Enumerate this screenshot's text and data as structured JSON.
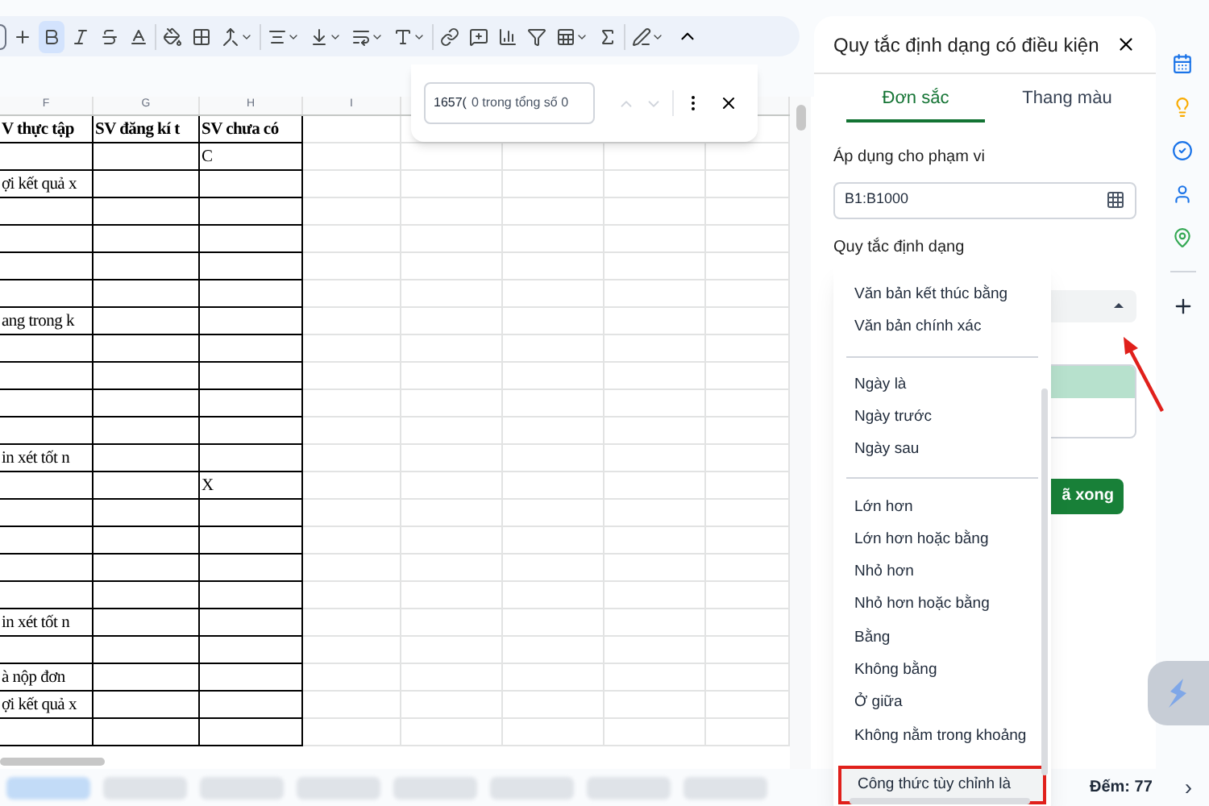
{
  "toolbar": {
    "bold_selected": true
  },
  "find_bar": {
    "value": "1657(",
    "count": "0 trong tổng số 0"
  },
  "sheet": {
    "columns": [
      "F",
      "G",
      "H",
      "I"
    ],
    "header_row": {
      "f": "V thực tập",
      "g": "SV đăng kí t",
      "h": "SV chưa có"
    },
    "rows": [
      {
        "h": "C"
      },
      {
        "f": "ợi kết quả x"
      },
      {},
      {},
      {},
      {},
      {
        "f": "ang trong k"
      },
      {},
      {},
      {},
      {},
      {
        "f": "in xét tốt n"
      },
      {
        "h": "X"
      },
      {},
      {},
      {},
      {},
      {
        "f": "in xét tốt n"
      },
      {},
      {
        "f": "à nộp đơn"
      },
      {
        "f": "ợi kết quả x"
      },
      {}
    ]
  },
  "sheet_tabs": [
    {
      "selected": true
    },
    {
      "selected": false
    },
    {
      "selected": false
    },
    {
      "selected": false
    },
    {
      "selected": false
    },
    {
      "selected": false
    },
    {
      "selected": false
    },
    {
      "selected": false
    }
  ],
  "status": {
    "count": "Đếm: 77",
    "next": "›"
  },
  "panel": {
    "title": "Quy tắc định dạng có điều kiện",
    "tabs": [
      {
        "label": "Đơn sắc",
        "selected": true
      },
      {
        "label": "Thang màu",
        "selected": false
      }
    ],
    "range_label": "Áp dụng cho phạm vi",
    "range_value": "B1:B1000",
    "rules_label": "Quy tắc định dạng",
    "done_button": "ã xong"
  },
  "condition_menu": {
    "items": [
      {
        "kind": "item",
        "label": "Văn bản kết thúc bằng",
        "highlighted": false
      },
      {
        "kind": "item",
        "label": "Văn bản chính xác",
        "highlighted": false
      },
      {
        "kind": "divider"
      },
      {
        "kind": "item",
        "label": "Ngày là",
        "highlighted": false
      },
      {
        "kind": "item",
        "label": "Ngày trước",
        "highlighted": false
      },
      {
        "kind": "item",
        "label": "Ngày sau",
        "highlighted": false
      },
      {
        "kind": "divider"
      },
      {
        "kind": "item",
        "label": "Lớn hơn",
        "highlighted": false
      },
      {
        "kind": "item",
        "label": "Lớn hơn hoặc bằng",
        "highlighted": false
      },
      {
        "kind": "item",
        "label": "Nhỏ hơn",
        "highlighted": false
      },
      {
        "kind": "item",
        "label": "Nhỏ hơn hoặc bằng",
        "highlighted": false
      },
      {
        "kind": "item",
        "label": "Bằng",
        "highlighted": false
      },
      {
        "kind": "item",
        "label": "Không bằng",
        "highlighted": false
      },
      {
        "kind": "item",
        "label": "Ở giữa",
        "highlighted": false
      },
      {
        "kind": "item",
        "label": "Không nằm trong khoảng",
        "highlighted": false
      },
      {
        "kind": "item",
        "label": "Công thức tùy chỉnh là",
        "highlighted": true
      }
    ]
  }
}
